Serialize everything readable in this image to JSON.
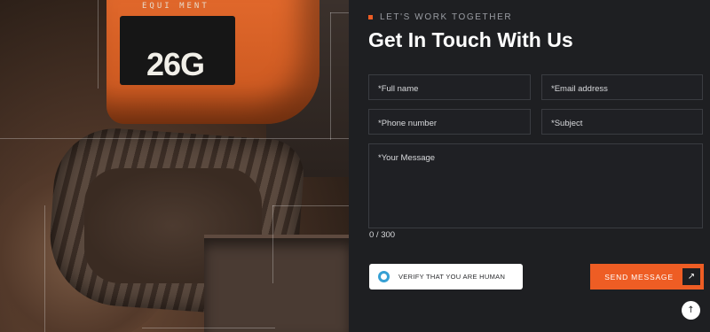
{
  "hero_image": {
    "brand_text": "EQUI MENT",
    "model_text": "26G"
  },
  "contact": {
    "eyebrow": "LET'S WORK TOGETHER",
    "title": "Get In Touch With Us",
    "fields": {
      "full_name": "*Full name",
      "email": "*Email address",
      "phone": "*Phone number",
      "subject": "*Subject",
      "message": "*Your Message"
    },
    "message_counter": "0 / 300",
    "captcha_label": "VERIFY THAT YOU ARE HUMAN",
    "send_label": "SEND MESSAGE",
    "send_icon": "arrow-up-right-icon",
    "back_to_top_icon": "arrow-up-icon"
  },
  "colors": {
    "accent": "#ee5d24",
    "background": "#1e1f22",
    "captcha_ring": "#36a0d4"
  }
}
